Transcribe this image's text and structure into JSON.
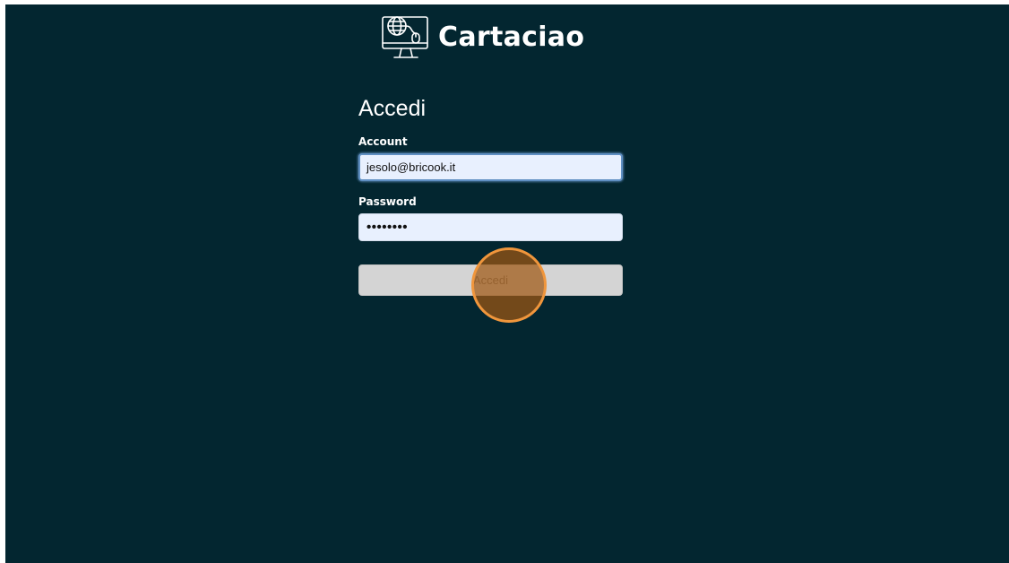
{
  "logo": {
    "icon": "computer-globe-mouse-icon",
    "text": "Cartaciao"
  },
  "login": {
    "title": "Accedi",
    "account_label": "Account",
    "account_value": "jesolo@bricook.it",
    "password_label": "Password",
    "password_value": "••••••••",
    "submit_label": "Accedi"
  },
  "colors": {
    "background": "#032630",
    "input_background": "#e8f0fe",
    "button_background": "#d4d4d4",
    "click_marker": "#f0963c"
  }
}
